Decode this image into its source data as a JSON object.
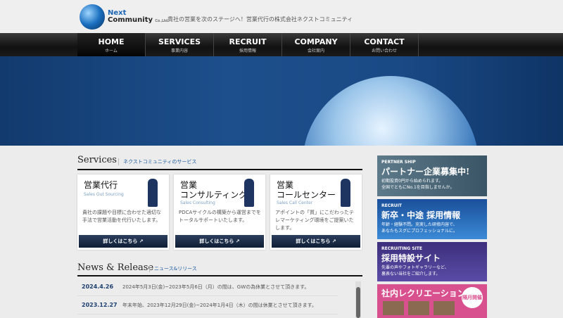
{
  "header": {
    "logo_line1": "Next",
    "logo_line2": "Community",
    "logo_suffix": "Co.,Ltd.",
    "tagline": "貴社の営業を次のステージへ！営業代行の株式会社ネクストコミュニティ"
  },
  "nav": [
    {
      "label": "HOME",
      "sub": "ホーム"
    },
    {
      "label": "SERVICES",
      "sub": "事業内容"
    },
    {
      "label": "RECRUIT",
      "sub": "採用情報"
    },
    {
      "label": "COMPANY",
      "sub": "会社案内"
    },
    {
      "label": "CONTACT",
      "sub": "お問い合わせ"
    }
  ],
  "services": {
    "title": "Services",
    "subtitle": "ネクストコミュニティのサービス",
    "cards": [
      {
        "title_l1": "営業代行",
        "title_l2": "",
        "en": "Sales Out Sourcing",
        "text": "貴社の課題や目標に合わせた適切な手法で営業活動を代行いたします。",
        "button": "詳しくはこちら ↗"
      },
      {
        "title_l1": "営業",
        "title_l2": "コンサルティング",
        "en": "Sales Consulting",
        "text": "PDCAサイクルの構築から運営までをトータルサポートいたします。",
        "button": "詳しくはこちら ↗"
      },
      {
        "title_l1": "営業",
        "title_l2": "コールセンター",
        "en": "Sales Call Center",
        "text": "アポイントの「質」にこだわったテレマーケティング環境をご提案いたします。",
        "button": "詳しくはこちら ↗"
      }
    ]
  },
  "news": {
    "title": "News & Release",
    "subtitle": "ニュース&リリース",
    "items": [
      {
        "date": "2024.4.26",
        "text": "2024年5月3日(金)~2023年5月6日（月）の間は、GWの為休業とさせて頂きます。"
      },
      {
        "date": "2023.12.27",
        "text": "年末年始、2023年12月29日(金)~2024年1月4日（木）の間は休業とさせて頂きます。"
      }
    ]
  },
  "banners": [
    {
      "kicker": "PERTNER SHIP",
      "heading": "パートナー企業募集中!",
      "text1": "初期投資0円から始められます。",
      "text2": "全国でともにNo.1を目指しませんか。",
      "color": "#4f6878"
    },
    {
      "kicker": "RECRUIT",
      "heading": "新卒・中途 採用情報",
      "text1": "年齢・経験不問。充実した研修内容で、",
      "text2": "あなたもスグにプロフェッショナルに。",
      "color": "#1d5aa8"
    },
    {
      "kicker": "RECRUITING SITE",
      "heading": "採用特設サイト",
      "text1": "先輩の声やフォトギャラリーなど、",
      "text2": "裏表ない当社をご紹介します。",
      "color": "#4a3d8c"
    },
    {
      "kicker": "",
      "heading": "社内レクリエーション",
      "text1": "隔月開催",
      "text2": "",
      "color": "#d9508f"
    }
  ]
}
